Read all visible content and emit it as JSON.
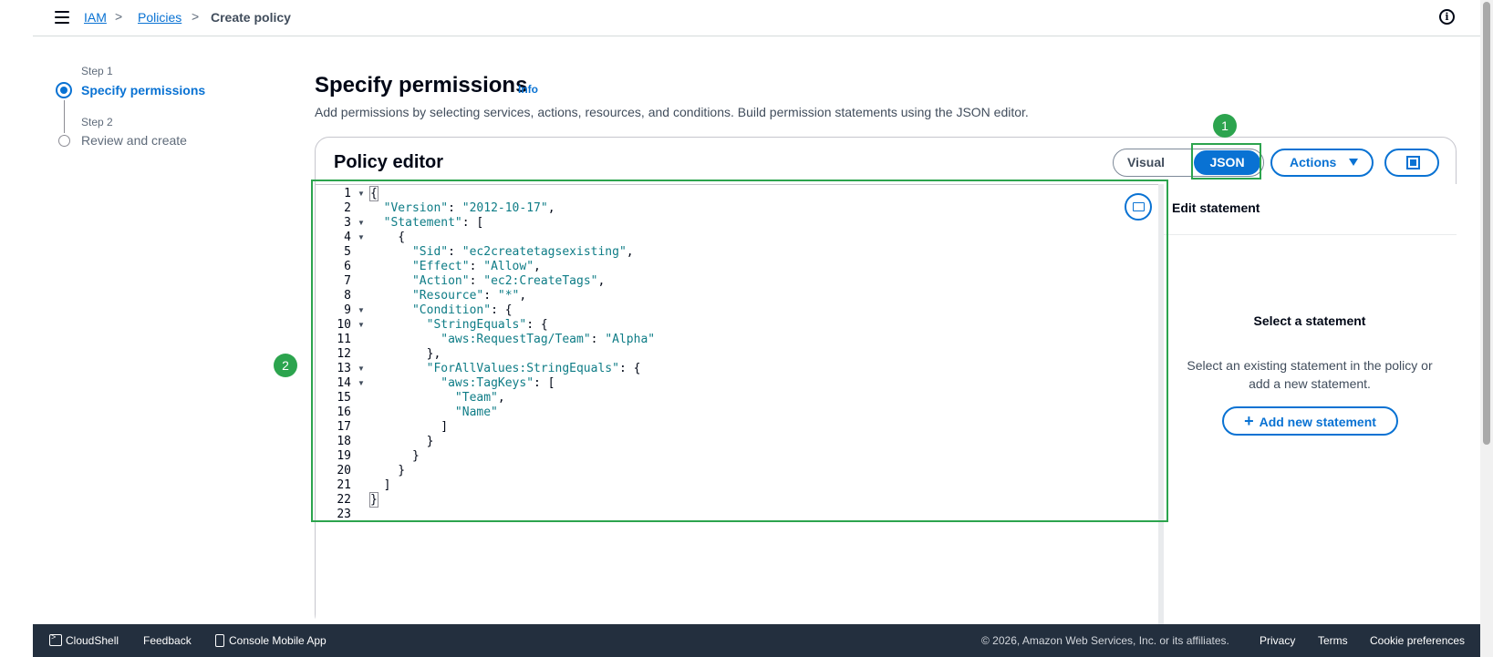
{
  "breadcrumb": {
    "iam": "IAM",
    "policies": "Policies",
    "current": "Create policy",
    "sep": ">"
  },
  "steps": [
    {
      "step": "Step 1",
      "name": "Specify permissions",
      "state": "active"
    },
    {
      "step": "Step 2",
      "name": "Review and create",
      "state": "inactive"
    }
  ],
  "header": {
    "title": "Specify permissions",
    "info": "Info",
    "description": "Add permissions by selecting services, actions, resources, and conditions. Build permission statements using the JSON editor."
  },
  "editor": {
    "title": "Policy editor",
    "mode_visual": "Visual",
    "mode_json": "JSON",
    "selected_mode": "JSON",
    "actions_label": "Actions",
    "lines": [
      "{",
      "  \"Version\": \"2012-10-17\",",
      "  \"Statement\": [",
      "    {",
      "      \"Sid\": \"ec2createtagsexisting\",",
      "      \"Effect\": \"Allow\",",
      "      \"Action\": \"ec2:CreateTags\",",
      "      \"Resource\": \"*\",",
      "      \"Condition\": {",
      "        \"StringEquals\": {",
      "          \"aws:RequestTag/Team\": \"Alpha\"",
      "        },",
      "        \"ForAllValues:StringEquals\": {",
      "          \"aws:TagKeys\": [",
      "            \"Team\",",
      "            \"Name\"",
      "          ]",
      "        }",
      "      }",
      "    }",
      "  ]",
      "}",
      ""
    ],
    "foldable_lines": [
      1,
      3,
      4,
      9,
      10,
      13,
      14
    ]
  },
  "statement_panel": {
    "title": "Edit statement",
    "empty_title": "Select a statement",
    "empty_desc": "Select an existing statement in the policy or add a new statement.",
    "add_button": "Add new statement",
    "add_icon": "+"
  },
  "annotations": [
    "1",
    "2"
  ],
  "footer": {
    "cloudshell": "CloudShell",
    "feedback": "Feedback",
    "mobile_app": "Console Mobile App",
    "copyright": "© 2026, Amazon Web Services, Inc. or its affiliates.",
    "privacy": "Privacy",
    "terms": "Terms",
    "cookies": "Cookie preferences"
  },
  "colors": {
    "accent": "#0972d3",
    "annotation": "#2ca44e",
    "footer_bg": "#232f3e",
    "code_key": "#0e7c86"
  }
}
